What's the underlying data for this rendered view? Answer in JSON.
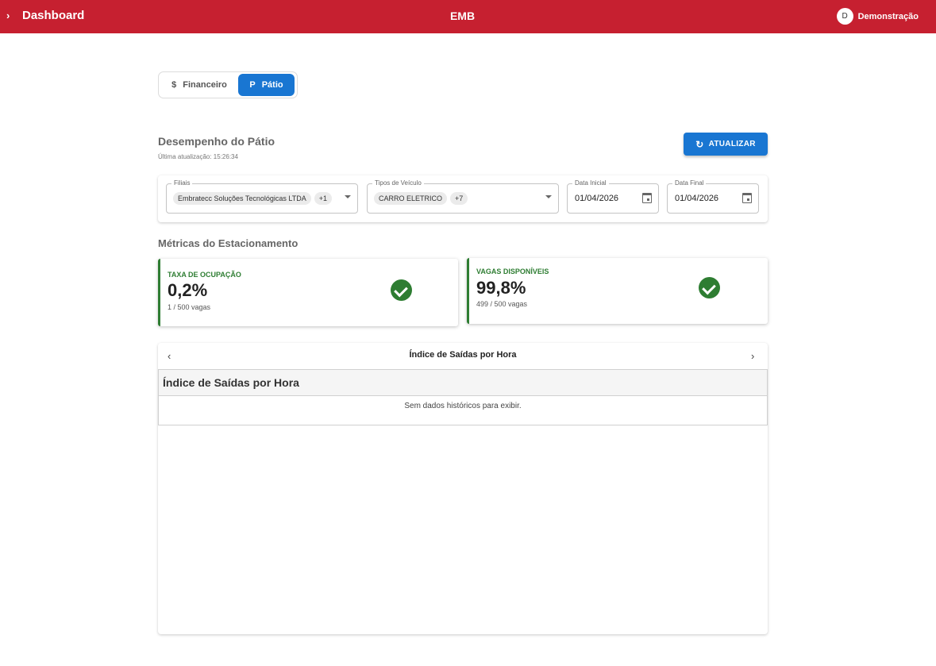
{
  "header": {
    "menu_icon": "chevron-right-icon",
    "menu_glyph": "›",
    "title": "Dashboard",
    "brand": "EMB",
    "user_initial": "D",
    "user_name": "Demonstração"
  },
  "view_toggle": {
    "options": [
      {
        "label": "Financeiro",
        "icon": "$",
        "selected": false
      },
      {
        "label": "Pátio",
        "icon": "P",
        "selected": true
      }
    ]
  },
  "page": {
    "title": "Desempenho do Pátio",
    "last_update": "Última atualização: 15:26:34",
    "refresh_label": "ATUALIZAR",
    "refresh_icon": "↻"
  },
  "filters": {
    "branches": {
      "label": "Filiais",
      "value": "Embratecc Soluções Tecnológicas LTDA",
      "extra": "+1"
    },
    "vehicle_types": {
      "label": "Tipos de Veículo",
      "value": "CARRO ELETRICO",
      "extra": "+7"
    },
    "start_date": {
      "label": "Data Inicial",
      "value": "01/04/2026"
    },
    "end_date": {
      "label": "Data Final",
      "value": "01/04/2026"
    }
  },
  "metrics": {
    "title": "Métricas do Estacionamento",
    "cards": [
      {
        "label": "TAXA DE OCUPAÇÃO",
        "value": "0,2%",
        "sub": "1 / 500 vagas",
        "status_icon": "check-circle-icon"
      },
      {
        "label": "VAGAS DISPONÍVEIS",
        "value": "99,8%",
        "sub": "499 / 500 vagas",
        "status_icon": "check-circle-icon"
      }
    ],
    "accent": "#2e7d32"
  },
  "carousel": {
    "title": "Índice de Saídas por Hora",
    "prev": "‹",
    "next": "›",
    "panel_title": "Índice de Saídas por Hora",
    "empty_message": "Sem dados históricos para exibir."
  },
  "colors": {
    "header": "#c62030",
    "primary": "#1976d2",
    "success": "#2e7d32"
  }
}
